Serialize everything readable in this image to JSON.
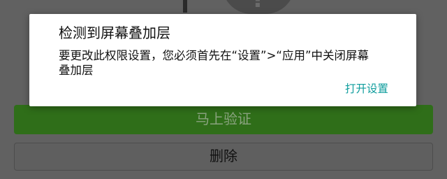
{
  "background": {
    "help_icon_text": "?",
    "verify_button_label": "马上验证",
    "delete_button_label": "删除"
  },
  "dialog": {
    "title": "检测到屏幕叠加层",
    "message": "要更改此权限设置，您必须首先在“设置”>“应用”中关闭屏幕叠加层",
    "action_label": "打开设置"
  },
  "colors": {
    "dim_background": "#616161",
    "verify_button": "#2f6e19",
    "accent": "#0f9d9d",
    "dialog_bg": "#ffffff"
  }
}
